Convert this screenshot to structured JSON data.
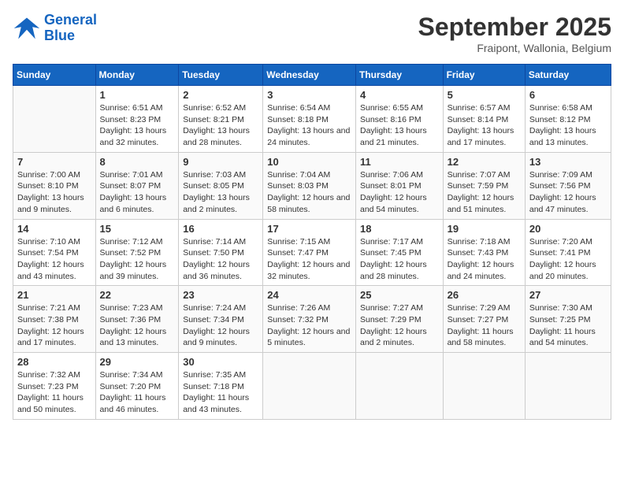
{
  "logo": {
    "line1": "General",
    "line2": "Blue"
  },
  "title": "September 2025",
  "location": "Fraipont, Wallonia, Belgium",
  "weekdays": [
    "Sunday",
    "Monday",
    "Tuesday",
    "Wednesday",
    "Thursday",
    "Friday",
    "Saturday"
  ],
  "weeks": [
    [
      {
        "day": "",
        "sunrise": "",
        "sunset": "",
        "daylight": ""
      },
      {
        "day": "1",
        "sunrise": "Sunrise: 6:51 AM",
        "sunset": "Sunset: 8:23 PM",
        "daylight": "Daylight: 13 hours and 32 minutes."
      },
      {
        "day": "2",
        "sunrise": "Sunrise: 6:52 AM",
        "sunset": "Sunset: 8:21 PM",
        "daylight": "Daylight: 13 hours and 28 minutes."
      },
      {
        "day": "3",
        "sunrise": "Sunrise: 6:54 AM",
        "sunset": "Sunset: 8:18 PM",
        "daylight": "Daylight: 13 hours and 24 minutes."
      },
      {
        "day": "4",
        "sunrise": "Sunrise: 6:55 AM",
        "sunset": "Sunset: 8:16 PM",
        "daylight": "Daylight: 13 hours and 21 minutes."
      },
      {
        "day": "5",
        "sunrise": "Sunrise: 6:57 AM",
        "sunset": "Sunset: 8:14 PM",
        "daylight": "Daylight: 13 hours and 17 minutes."
      },
      {
        "day": "6",
        "sunrise": "Sunrise: 6:58 AM",
        "sunset": "Sunset: 8:12 PM",
        "daylight": "Daylight: 13 hours and 13 minutes."
      }
    ],
    [
      {
        "day": "7",
        "sunrise": "Sunrise: 7:00 AM",
        "sunset": "Sunset: 8:10 PM",
        "daylight": "Daylight: 13 hours and 9 minutes."
      },
      {
        "day": "8",
        "sunrise": "Sunrise: 7:01 AM",
        "sunset": "Sunset: 8:07 PM",
        "daylight": "Daylight: 13 hours and 6 minutes."
      },
      {
        "day": "9",
        "sunrise": "Sunrise: 7:03 AM",
        "sunset": "Sunset: 8:05 PM",
        "daylight": "Daylight: 13 hours and 2 minutes."
      },
      {
        "day": "10",
        "sunrise": "Sunrise: 7:04 AM",
        "sunset": "Sunset: 8:03 PM",
        "daylight": "Daylight: 12 hours and 58 minutes."
      },
      {
        "day": "11",
        "sunrise": "Sunrise: 7:06 AM",
        "sunset": "Sunset: 8:01 PM",
        "daylight": "Daylight: 12 hours and 54 minutes."
      },
      {
        "day": "12",
        "sunrise": "Sunrise: 7:07 AM",
        "sunset": "Sunset: 7:59 PM",
        "daylight": "Daylight: 12 hours and 51 minutes."
      },
      {
        "day": "13",
        "sunrise": "Sunrise: 7:09 AM",
        "sunset": "Sunset: 7:56 PM",
        "daylight": "Daylight: 12 hours and 47 minutes."
      }
    ],
    [
      {
        "day": "14",
        "sunrise": "Sunrise: 7:10 AM",
        "sunset": "Sunset: 7:54 PM",
        "daylight": "Daylight: 12 hours and 43 minutes."
      },
      {
        "day": "15",
        "sunrise": "Sunrise: 7:12 AM",
        "sunset": "Sunset: 7:52 PM",
        "daylight": "Daylight: 12 hours and 39 minutes."
      },
      {
        "day": "16",
        "sunrise": "Sunrise: 7:14 AM",
        "sunset": "Sunset: 7:50 PM",
        "daylight": "Daylight: 12 hours and 36 minutes."
      },
      {
        "day": "17",
        "sunrise": "Sunrise: 7:15 AM",
        "sunset": "Sunset: 7:47 PM",
        "daylight": "Daylight: 12 hours and 32 minutes."
      },
      {
        "day": "18",
        "sunrise": "Sunrise: 7:17 AM",
        "sunset": "Sunset: 7:45 PM",
        "daylight": "Daylight: 12 hours and 28 minutes."
      },
      {
        "day": "19",
        "sunrise": "Sunrise: 7:18 AM",
        "sunset": "Sunset: 7:43 PM",
        "daylight": "Daylight: 12 hours and 24 minutes."
      },
      {
        "day": "20",
        "sunrise": "Sunrise: 7:20 AM",
        "sunset": "Sunset: 7:41 PM",
        "daylight": "Daylight: 12 hours and 20 minutes."
      }
    ],
    [
      {
        "day": "21",
        "sunrise": "Sunrise: 7:21 AM",
        "sunset": "Sunset: 7:38 PM",
        "daylight": "Daylight: 12 hours and 17 minutes."
      },
      {
        "day": "22",
        "sunrise": "Sunrise: 7:23 AM",
        "sunset": "Sunset: 7:36 PM",
        "daylight": "Daylight: 12 hours and 13 minutes."
      },
      {
        "day": "23",
        "sunrise": "Sunrise: 7:24 AM",
        "sunset": "Sunset: 7:34 PM",
        "daylight": "Daylight: 12 hours and 9 minutes."
      },
      {
        "day": "24",
        "sunrise": "Sunrise: 7:26 AM",
        "sunset": "Sunset: 7:32 PM",
        "daylight": "Daylight: 12 hours and 5 minutes."
      },
      {
        "day": "25",
        "sunrise": "Sunrise: 7:27 AM",
        "sunset": "Sunset: 7:29 PM",
        "daylight": "Daylight: 12 hours and 2 minutes."
      },
      {
        "day": "26",
        "sunrise": "Sunrise: 7:29 AM",
        "sunset": "Sunset: 7:27 PM",
        "daylight": "Daylight: 11 hours and 58 minutes."
      },
      {
        "day": "27",
        "sunrise": "Sunrise: 7:30 AM",
        "sunset": "Sunset: 7:25 PM",
        "daylight": "Daylight: 11 hours and 54 minutes."
      }
    ],
    [
      {
        "day": "28",
        "sunrise": "Sunrise: 7:32 AM",
        "sunset": "Sunset: 7:23 PM",
        "daylight": "Daylight: 11 hours and 50 minutes."
      },
      {
        "day": "29",
        "sunrise": "Sunrise: 7:34 AM",
        "sunset": "Sunset: 7:20 PM",
        "daylight": "Daylight: 11 hours and 46 minutes."
      },
      {
        "day": "30",
        "sunrise": "Sunrise: 7:35 AM",
        "sunset": "Sunset: 7:18 PM",
        "daylight": "Daylight: 11 hours and 43 minutes."
      },
      {
        "day": "",
        "sunrise": "",
        "sunset": "",
        "daylight": ""
      },
      {
        "day": "",
        "sunrise": "",
        "sunset": "",
        "daylight": ""
      },
      {
        "day": "",
        "sunrise": "",
        "sunset": "",
        "daylight": ""
      },
      {
        "day": "",
        "sunrise": "",
        "sunset": "",
        "daylight": ""
      }
    ]
  ]
}
